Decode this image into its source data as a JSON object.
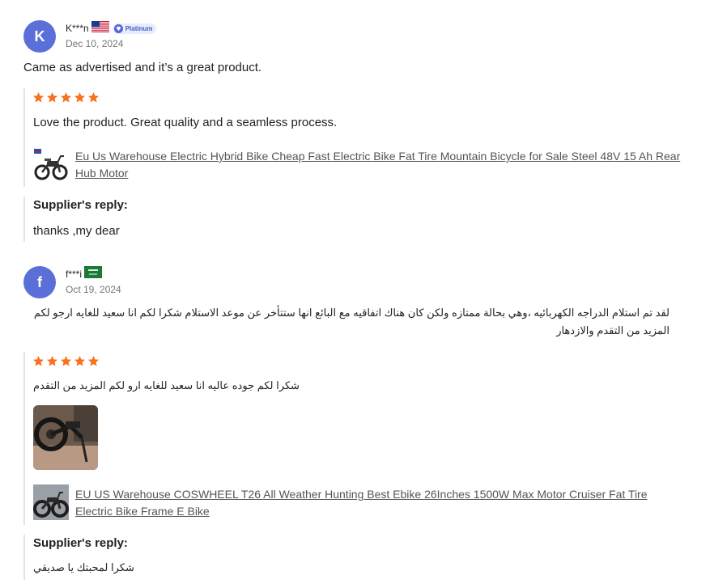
{
  "colors": {
    "avatar_k": "#5a6fd8",
    "avatar_f": "#5a6fd8",
    "star": "#f7711e",
    "badge_bg": "#e6edfb",
    "badge_text": "#4658c8"
  },
  "reviews": [
    {
      "avatar_letter": "K",
      "username": "K***n",
      "flag": "us-flag-icon",
      "badge": "Platinum",
      "date": "Dec 10, 2024",
      "comment": "Came as advertised and it’s a great product.",
      "rating": 5,
      "rating_comment": "Love the product. Great quality and a seamless process.",
      "product": {
        "icon": "electric-bike-thumbnail",
        "title": "Eu Us Warehouse Electric Hybrid Bike Cheap Fast Electric Bike Fat Tire Mountain Bicycle for Sale Steel 48V 15 Ah Rear Hub Motor"
      },
      "reply_label": "Supplier's reply:",
      "reply": "thanks ,my dear"
    },
    {
      "avatar_letter": "f",
      "username": "f***i",
      "flag": "saudi-flag-icon",
      "date": "Oct 19, 2024",
      "comment": "لقد تم استلام الدراجه الكهربائيه ،وهي بحالة ممتازه ولكن كان هناك اتفاقيه مع البائع انها ستتأخر عن موعد الاستلام شكرا لكم انا سعيد للغايه ارجو لكم المزيد من التقدم والازدهار",
      "rating": 5,
      "rating_comment": "شكرا لكم جوده عاليه انا سعيد للغايه ارو لكم المزيد من التقدم",
      "photo": "review-photo-bike",
      "product": {
        "icon": "cruiser-bike-thumbnail",
        "title": "EU US Warehouse COSWHEEL T26 All Weather Hunting Best Ebike 26Inches 1500W Max Motor Cruiser Fat Tire Electric Bike Frame E Bike"
      },
      "reply_label": "Supplier's reply:",
      "reply": "شكرا لمحبتك يا صديقي"
    }
  ]
}
